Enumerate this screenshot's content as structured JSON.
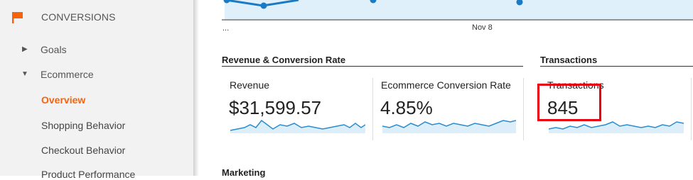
{
  "sidebar": {
    "section_title": "CONVERSIONS",
    "items": [
      {
        "label": "Goals",
        "expand": "▶"
      },
      {
        "label": "Ecommerce",
        "expand": "▼"
      },
      {
        "label": "Overview"
      },
      {
        "label": "Shopping Behavior"
      },
      {
        "label": "Checkout Behavior"
      },
      {
        "label": "Product Performance"
      }
    ],
    "active_color": "#f7630c"
  },
  "timeline": {
    "start_label": "...",
    "date_label": "Nov 8",
    "series_color": "#1a7bc4"
  },
  "sections": {
    "revenue_conversion": "Revenue & Conversion Rate",
    "transactions": "Transactions",
    "marketing": "Marketing"
  },
  "metrics": [
    {
      "label": "Revenue",
      "value": "$31,599.57"
    },
    {
      "label": "Ecommerce Conversion Rate",
      "value": "4.85%"
    },
    {
      "label": "Transactions",
      "value": "845"
    }
  ],
  "highlight_color": "#e8000f"
}
